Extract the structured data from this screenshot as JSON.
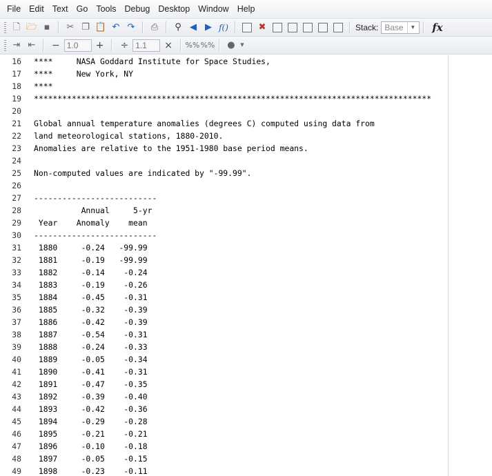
{
  "menu": [
    "File",
    "Edit",
    "Text",
    "Go",
    "Tools",
    "Debug",
    "Desktop",
    "Window",
    "Help"
  ],
  "toolbar": {
    "stack_label": "Stack:",
    "stack_value": "Base",
    "fx": "fx",
    "decrement_symbol": "−",
    "cell_break_value": "1.0",
    "increment_symbol": "+",
    "divide_symbol": "÷",
    "cell_width_value": "1.1",
    "multiply_symbol": "×"
  },
  "lines": [
    {
      "n": "16",
      "text": "****     NASA Goddard Institute for Space Studies,"
    },
    {
      "n": "17",
      "text": "****     New York, NY"
    },
    {
      "n": "18",
      "text": "****"
    },
    {
      "n": "19",
      "text": "************************************************************************************"
    },
    {
      "n": "20",
      "text": ""
    },
    {
      "n": "21",
      "text": "Global annual temperature anomalies (degrees C) computed using data from"
    },
    {
      "n": "22",
      "text": "land meteorological stations, 1880-2010."
    },
    {
      "n": "23",
      "text": "Anomalies are relative to the 1951-1980 base period means."
    },
    {
      "n": "24",
      "text": ""
    },
    {
      "n": "25",
      "text": "Non-computed values are indicated by \"-99.99\"."
    },
    {
      "n": "26",
      "text": ""
    },
    {
      "n": "27",
      "text": "--------------------------"
    },
    {
      "n": "28",
      "text": "          Annual     5-yr"
    },
    {
      "n": "29",
      "text": " Year    Anomaly    mean"
    },
    {
      "n": "30",
      "text": "--------------------------"
    },
    {
      "n": "31",
      "text": " 1880     -0.24   -99.99"
    },
    {
      "n": "32",
      "text": " 1881     -0.19   -99.99"
    },
    {
      "n": "33",
      "text": " 1882     -0.14    -0.24"
    },
    {
      "n": "34",
      "text": " 1883     -0.19    -0.26"
    },
    {
      "n": "35",
      "text": " 1884     -0.45    -0.31"
    },
    {
      "n": "36",
      "text": " 1885     -0.32    -0.39"
    },
    {
      "n": "37",
      "text": " 1886     -0.42    -0.39"
    },
    {
      "n": "38",
      "text": " 1887     -0.54    -0.31"
    },
    {
      "n": "39",
      "text": " 1888     -0.24    -0.33"
    },
    {
      "n": "40",
      "text": " 1889     -0.05    -0.34"
    },
    {
      "n": "41",
      "text": " 1890     -0.41    -0.31"
    },
    {
      "n": "42",
      "text": " 1891     -0.47    -0.35"
    },
    {
      "n": "43",
      "text": " 1892     -0.39    -0.40"
    },
    {
      "n": "44",
      "text": " 1893     -0.42    -0.36"
    },
    {
      "n": "45",
      "text": " 1894     -0.29    -0.28"
    },
    {
      "n": "46",
      "text": " 1895     -0.21    -0.21"
    },
    {
      "n": "47",
      "text": " 1896     -0.10    -0.18"
    },
    {
      "n": "48",
      "text": " 1897     -0.05    -0.15"
    },
    {
      "n": "49",
      "text": " 1898     -0.23    -0.11"
    }
  ]
}
